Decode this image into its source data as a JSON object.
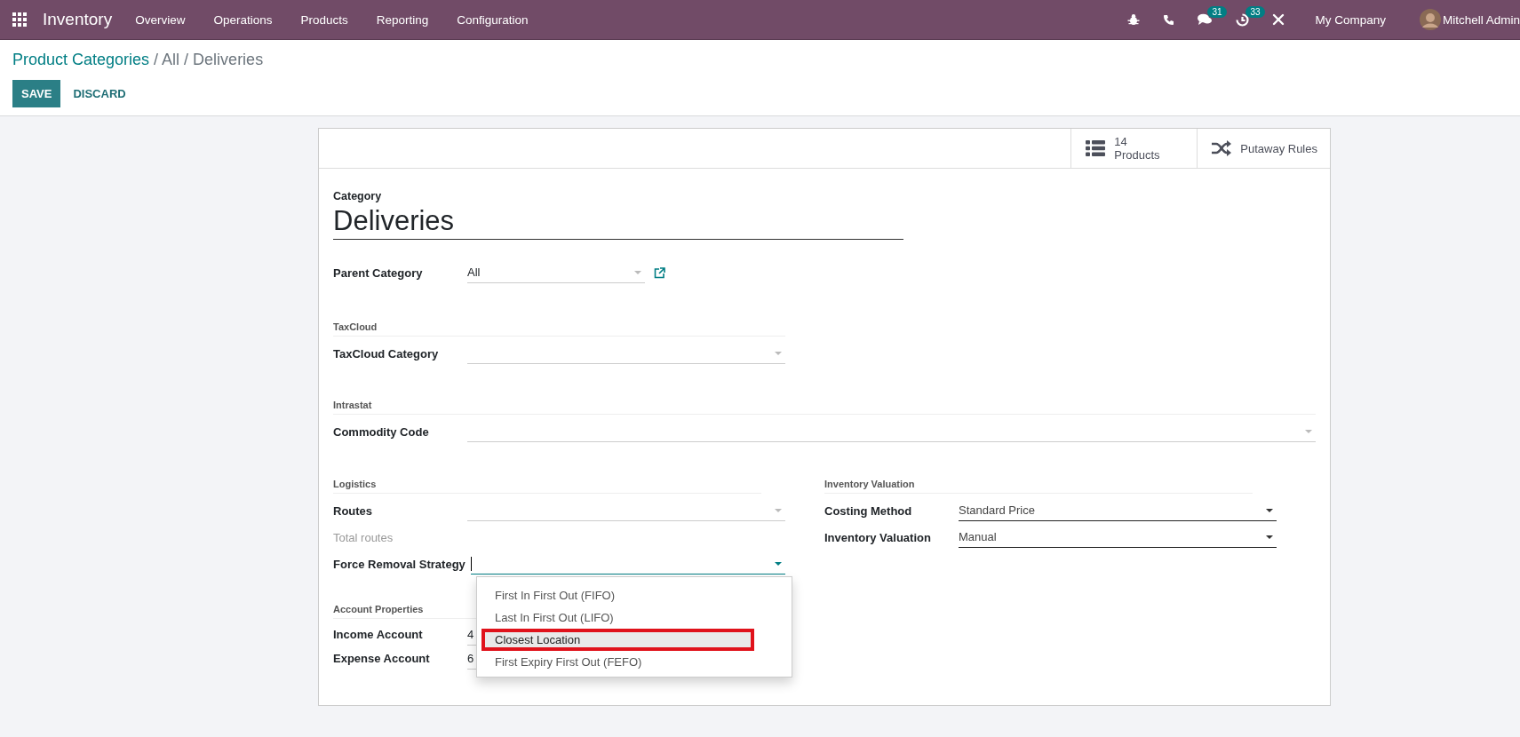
{
  "navbar": {
    "app_name": "Inventory",
    "menus": [
      "Overview",
      "Operations",
      "Products",
      "Reporting",
      "Configuration"
    ],
    "messages_badge": "31",
    "activities_badge": "33",
    "company": "My Company",
    "user": "Mitchell Admin"
  },
  "breadcrumb": {
    "link": "Product Categories",
    "rest": "/ All / Deliveries"
  },
  "actions": {
    "save": "SAVE",
    "discard": "DISCARD"
  },
  "button_box": [
    {
      "kind": "stat",
      "value": "14",
      "label": "Products"
    },
    {
      "kind": "action",
      "label": "Putaway Rules"
    }
  ],
  "category": {
    "label": "Category",
    "name": "Deliveries"
  },
  "parent_category": {
    "label": "Parent Category",
    "value": "All"
  },
  "taxcloud": {
    "title": "TaxCloud",
    "fields": [
      {
        "label": "TaxCloud Category"
      }
    ]
  },
  "intrastat": {
    "title": "Intrastat",
    "fields": [
      {
        "label": "Commodity Code"
      }
    ]
  },
  "logistics": {
    "title": "Logistics",
    "fields": [
      {
        "label": "Routes",
        "kind": "select"
      },
      {
        "label": "Total routes",
        "kind": "muted"
      },
      {
        "label": "Force Removal Strategy",
        "kind": "focused"
      }
    ]
  },
  "removal_dropdown": [
    {
      "label": "First In First Out (FIFO)",
      "selected": false
    },
    {
      "label": "Last In First Out (LIFO)",
      "selected": false
    },
    {
      "label": "Closest Location",
      "selected": true
    },
    {
      "label": "First Expiry First Out (FEFO)",
      "selected": false
    }
  ],
  "account_properties": {
    "title": "Account Properties",
    "fields": [
      {
        "label": "Income Account",
        "value": "4"
      },
      {
        "label": "Expense Account",
        "value": "6"
      }
    ]
  },
  "inventory_valuation": {
    "title": "Inventory Valuation",
    "fields": [
      {
        "label": "Costing Method",
        "value": "Standard Price",
        "kind": "required"
      },
      {
        "label": "Inventory Valuation",
        "value": "Manual",
        "kind": "required"
      }
    ]
  }
}
